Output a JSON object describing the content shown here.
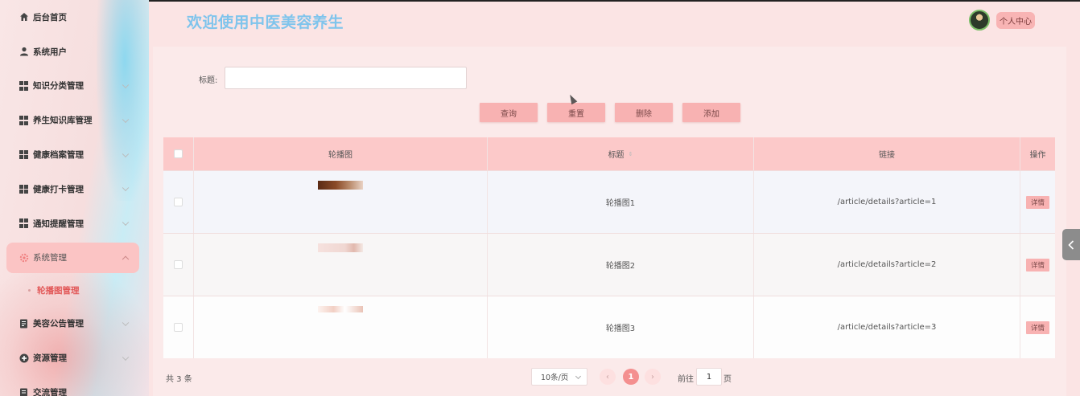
{
  "sidebar": {
    "items": [
      {
        "label": "后台首页",
        "icon": "home-icon",
        "has_chevron": false
      },
      {
        "label": "系统用户",
        "icon": "user-icon",
        "has_chevron": true
      },
      {
        "label": "知识分类管理",
        "icon": "grid-icon",
        "has_chevron": true
      },
      {
        "label": "养生知识库管理",
        "icon": "grid-icon",
        "has_chevron": true
      },
      {
        "label": "健康档案管理",
        "icon": "grid-icon",
        "has_chevron": true
      },
      {
        "label": "健康打卡管理",
        "icon": "grid-icon",
        "has_chevron": true
      },
      {
        "label": "通知提醒管理",
        "icon": "grid-icon",
        "has_chevron": true
      },
      {
        "label": "系统管理",
        "icon": "gear-icon",
        "has_chevron": true,
        "active": true
      },
      {
        "label": "美容公告管理",
        "icon": "document-icon",
        "has_chevron": true
      },
      {
        "label": "资源管理",
        "icon": "plus-circle-icon",
        "has_chevron": true
      },
      {
        "label": "交流管理",
        "icon": "document-icon",
        "has_chevron": true
      }
    ],
    "submenu": {
      "label": "轮播图管理"
    }
  },
  "header": {
    "title": "欢迎使用中医美容养生",
    "user_button": "个人中心"
  },
  "search": {
    "label": "标题:",
    "value": ""
  },
  "toolbar": {
    "query_label": "查询",
    "reset_label": "重置",
    "delete_label": "删除",
    "add_label": "添加"
  },
  "table": {
    "columns": [
      "轮播图",
      "标题",
      "链接",
      "操作"
    ],
    "rows": [
      {
        "title": "轮播图1",
        "link": "/article/details?article=1",
        "action": "详情"
      },
      {
        "title": "轮播图2",
        "link": "/article/details?article=2",
        "action": "详情"
      },
      {
        "title": "轮播图3",
        "link": "/article/details?article=3",
        "action": "详情"
      }
    ]
  },
  "pagination": {
    "total_text": "共 3 条",
    "page_size": "10条/页",
    "prev": "‹",
    "next": "›",
    "current_page": "1",
    "goto_label": "前往",
    "goto_value": "1",
    "goto_suffix": "页"
  },
  "colors": {
    "accent": "#f8b2b2",
    "title": "#7fc4ec",
    "table_header": "#fcc9c9",
    "current_page": "#f48f8f"
  }
}
